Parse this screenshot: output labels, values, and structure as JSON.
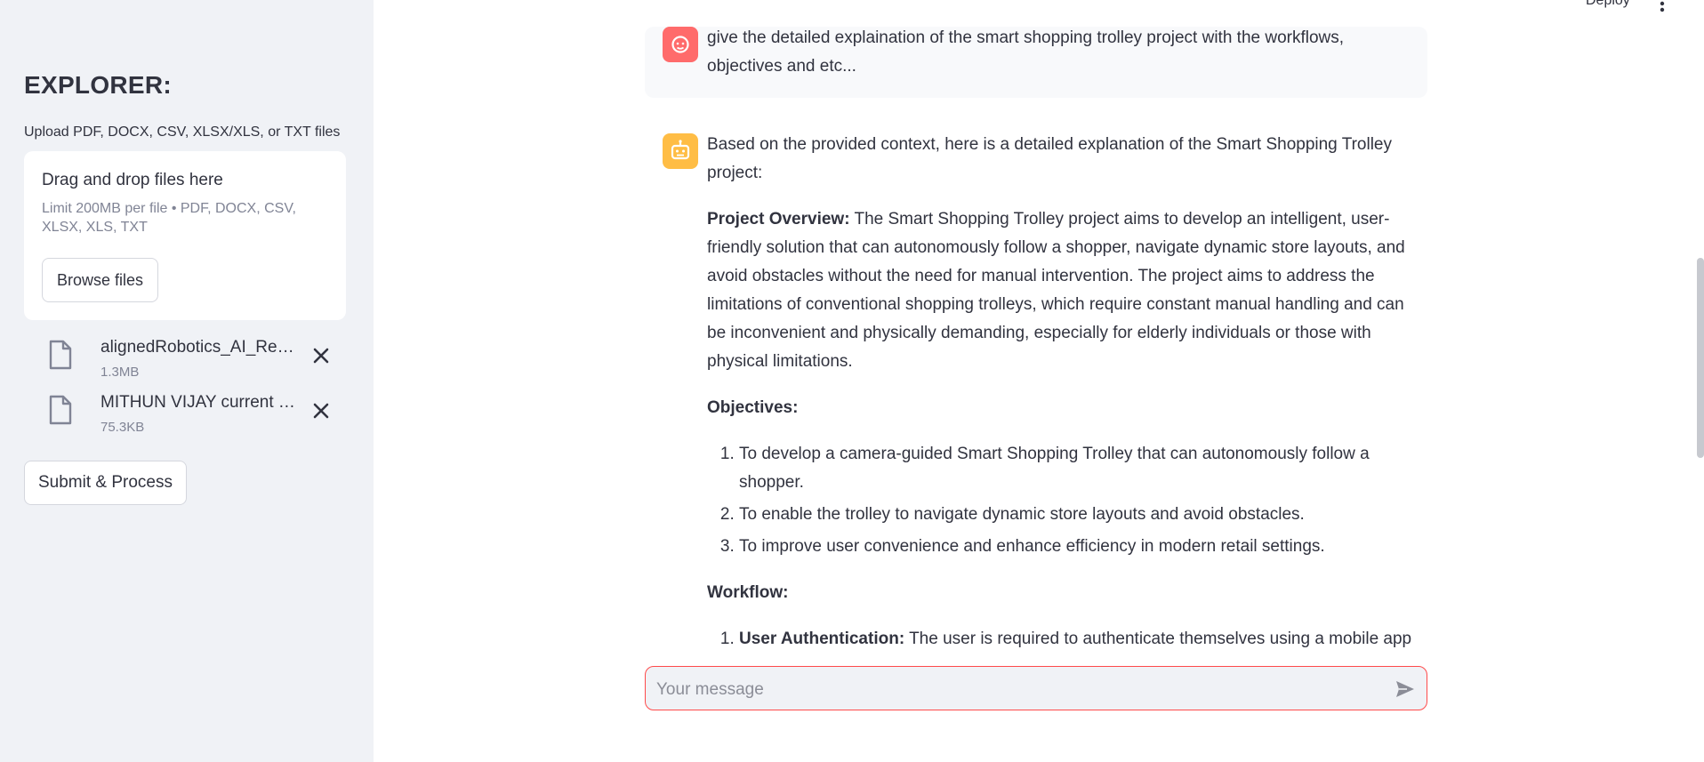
{
  "sidebar": {
    "title": "EXPLORER:",
    "upload_label": "Upload PDF, DOCX, CSV, XLSX/XLS, or TXT files",
    "dropzone": {
      "title": "Drag and drop files here",
      "limit": "Limit 200MB per file • PDF, DOCX, CSV, XLSX, XLS, TXT",
      "browse_label": "Browse files"
    },
    "files": [
      {
        "name": "alignedRobotics_AI_Report.pdf",
        "size": "1.3MB"
      },
      {
        "name": "MITHUN VIJAY current Resume.pdf",
        "size": "75.3KB"
      }
    ],
    "submit_label": "Submit & Process"
  },
  "topbar": {
    "deploy_label": "Deploy",
    "menu_icon": "more-vertical-icon"
  },
  "chat": {
    "user_message": "give the detailed explaination of the smart shopping trolley project with the workflows, objectives and etc...",
    "bot": {
      "intro": "Based on the provided context, here is a detailed explanation of the Smart Shopping Trolley project:",
      "overview_label": "Project Overview:",
      "overview_text": " The Smart Shopping Trolley project aims to develop an intelligent, user-friendly solution that can autonomously follow a shopper, navigate dynamic store layouts, and avoid obstacles without the need for manual intervention. The project aims to address the limitations of conventional shopping trolleys, which require constant manual handling and can be inconvenient and physically demanding, especially for elderly individuals or those with physical limitations.",
      "objectives_label": "Objectives:",
      "objectives": [
        "To develop a camera-guided Smart Shopping Trolley that can autonomously follow a shopper.",
        "To enable the trolley to navigate dynamic store layouts and avoid obstacles.",
        "To improve user convenience and enhance efficiency in modern retail settings."
      ],
      "workflow_label": "Workflow:",
      "workflow_first_label": "User Authentication:",
      "workflow_first_text": " The user is required to authenticate themselves using a mobile app or a"
    },
    "input_placeholder": "Your message"
  },
  "colors": {
    "accent": "#ff4b4b",
    "user_avatar": "#ff6b6b",
    "bot_avatar": "#ffbd45",
    "sidebar_bg": "#f0f2f6"
  }
}
